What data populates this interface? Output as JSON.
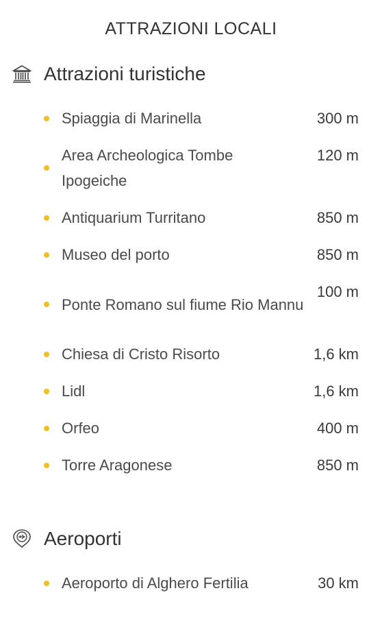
{
  "page": {
    "title": "ATTRAZIONI LOCALI"
  },
  "sections": [
    {
      "icon": "museum-icon",
      "title": "Attrazioni turistiche",
      "items": [
        {
          "name": "Spiaggia di Marinella",
          "distance": "300 m"
        },
        {
          "name": "Area Archeologica Tombe Ipogeiche",
          "distance": "120 m"
        },
        {
          "name": "Antiquarium Turritano",
          "distance": "850 m"
        },
        {
          "name": "Museo del porto",
          "distance": "850 m"
        },
        {
          "name": "Ponte Romano sul fiume Rio Mannu",
          "distance": "100 m"
        },
        {
          "name": "Chiesa di Cristo Risorto",
          "distance": "1,6 km"
        },
        {
          "name": "Lidl",
          "distance": "1,6 km"
        },
        {
          "name": "Orfeo",
          "distance": "400 m"
        },
        {
          "name": "Torre Aragonese",
          "distance": "850 m"
        }
      ]
    },
    {
      "icon": "airport-icon",
      "title": "Aeroporti",
      "items": [
        {
          "name": "Aeroporto di Alghero Fertilia",
          "distance": "30 km"
        }
      ]
    }
  ],
  "colors": {
    "bullet": "#f2c01e",
    "text": "#3a3a3a"
  }
}
